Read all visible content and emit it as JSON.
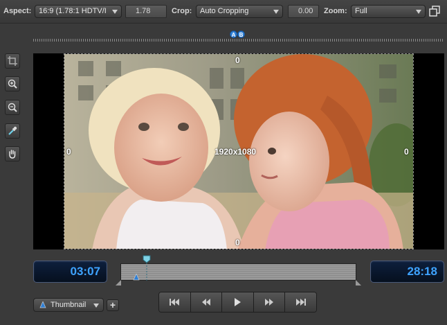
{
  "toolbar": {
    "aspect_label": "Aspect:",
    "aspect_value": "16:9 (1.78:1 HDTV/I",
    "aspect_ratio": "1.78",
    "crop_label": "Crop:",
    "crop_value": "Auto Cropping",
    "crop_amount": "0.00",
    "zoom_label": "Zoom:",
    "zoom_value": "Full"
  },
  "ruler": {
    "marker_a": "A",
    "marker_b": "B"
  },
  "tools": [
    "crop-tool-icon",
    "zoom-in-icon",
    "zoom-out-icon",
    "eyedropper-icon",
    "hand-icon"
  ],
  "preview": {
    "top_offset": "0",
    "bottom_offset": "0",
    "left_offset": "0",
    "right_offset": "0",
    "resolution": "1920x1080"
  },
  "timeline": {
    "in_time": "03:07",
    "out_time": "28:18"
  },
  "bottom": {
    "thumbnail_label": "Thumbnail",
    "add_label": "+"
  },
  "colors": {
    "accent": "#3ea3ff",
    "marker": "#2e7fd6",
    "background": "#3a3a3a"
  }
}
